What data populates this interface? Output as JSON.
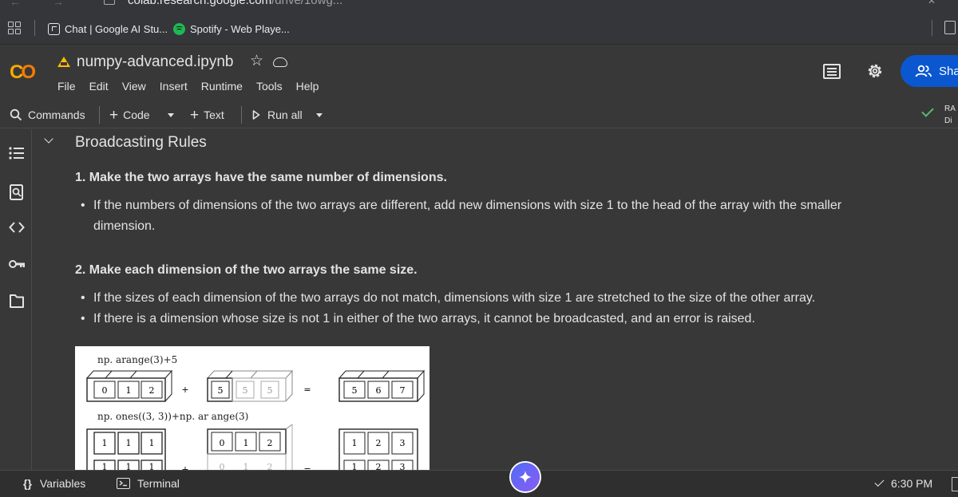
{
  "browser": {
    "url_host": "colab.research.google.com",
    "url_path": "/drive/1owg..."
  },
  "bookmarks": [
    {
      "label": "Chat | Google AI Stu...",
      "icon": "ai-studio-icon"
    },
    {
      "label": "Spotify - Web Playe...",
      "icon": "spotify-icon"
    }
  ],
  "notebook": {
    "title": "numpy-advanced.ipynb",
    "menu": [
      "File",
      "Edit",
      "View",
      "Insert",
      "Runtime",
      "Tools",
      "Help"
    ],
    "share_label": "Sha"
  },
  "toolbar": {
    "commands": "Commands",
    "code": "Code",
    "text": "Text",
    "run_all": "Run all",
    "ram_line1": "RA",
    "ram_line2": "Di"
  },
  "section": {
    "title": "Broadcasting Rules",
    "rule1": {
      "heading": "1. Make the two arrays have the same number of dimensions.",
      "bullets": [
        "If the numbers of dimensions of the two arrays are different, add new dimensions with size 1 to the head of the array with the smaller dimension."
      ]
    },
    "rule2": {
      "heading": "2. Make each dimension of the two arrays the same size.",
      "bullets": [
        "If the sizes of each dimension of the two arrays do not match, dimensions with size 1 are stretched to the size of the other array.",
        "If there is a dimension whose size is not 1 in either of the two arrays, it cannot be broadcasted, and an error is raised."
      ]
    }
  },
  "figure": {
    "example1_label": "np. arange(3)+5",
    "example1_a": [
      "0",
      "1",
      "2"
    ],
    "plus": "+",
    "equals": "=",
    "example1_b": [
      "5",
      "5",
      "5"
    ],
    "example1_result": [
      "5",
      "6",
      "7"
    ],
    "example2_label": "np. ones((3, 3))+np. ar ange(3)",
    "example2_a_row1": [
      "1",
      "1",
      "1"
    ],
    "example2_b_row1": [
      "0",
      "1",
      "2"
    ],
    "example2_result_row1": [
      "1",
      "2",
      "3"
    ],
    "example2_a_row2": [
      "1",
      "1",
      "1"
    ],
    "example2_b_row2": [
      "0",
      "1",
      "2"
    ],
    "example2_result_row2": [
      "1",
      "2",
      "3"
    ]
  },
  "statusbar": {
    "variables": "Variables",
    "terminal": "Terminal",
    "time": "6:30 PM"
  },
  "colors": {
    "background": "#383838",
    "share_button": "#0b57d0",
    "status_ok": "#5bb974",
    "colab_orange": "#f9ab00"
  }
}
